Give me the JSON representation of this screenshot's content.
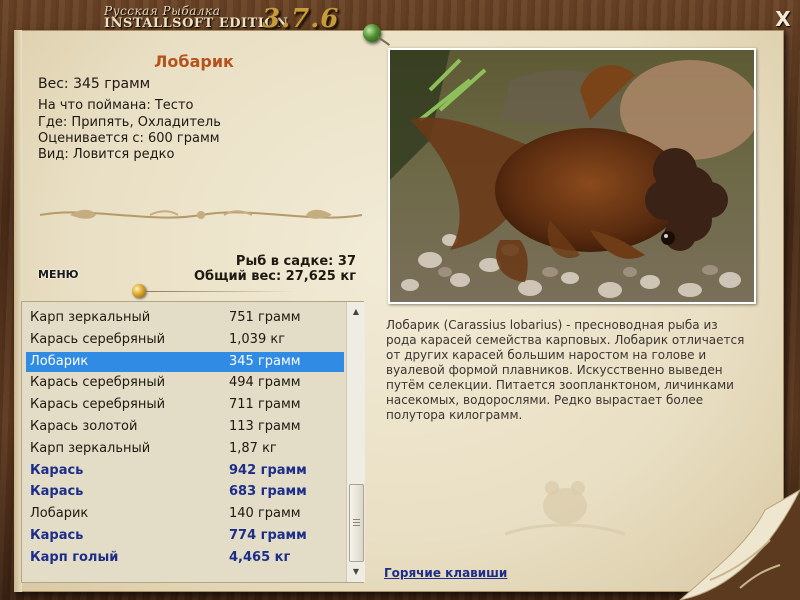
{
  "window": {
    "title_top": "Русская Рыбалка",
    "title_main": "INSTALLSOFT EDITION",
    "version": "3.7.6",
    "close_label": "X"
  },
  "fish": {
    "name": "Лобарик",
    "weight": "Вес: 345 грамм",
    "caught_on": "На что поймана: Тесто",
    "where": "Где: Припять, Охладитель",
    "rated_from": "Оценивается с: 600 грамм",
    "kind": "Вид: Ловится редко",
    "description": "Лобарик (Carassius lobarius) - пресноводная рыба из рода карасей семейства карповых. Лобарик отличается от других карасей большим наростом на голове и вуалевой формой плавников. Искусственно выведен путём селекции. Питается зоопланктоном, личинками насекомых, водорослями. Редко вырастает более полутора килограмм."
  },
  "cage": {
    "count": "Рыб в садке: 37",
    "total_weight": "Общий вес: 27,625 кг"
  },
  "menu_label": "МЕНЮ",
  "hotkeys_label": "Горячие клавиши",
  "catch_list": [
    {
      "name": "Карп зеркальный",
      "weight": "751 грамм",
      "style": "normal"
    },
    {
      "name": "Карась серебряный",
      "weight": "1,039 кг",
      "style": "normal"
    },
    {
      "name": "Лобарик",
      "weight": "345 грамм",
      "style": "selected"
    },
    {
      "name": "Карась серебряный",
      "weight": "494 грамм",
      "style": "normal"
    },
    {
      "name": "Карась серебряный",
      "weight": "711 грамм",
      "style": "normal"
    },
    {
      "name": "Карась золотой",
      "weight": "113 грамм",
      "style": "normal"
    },
    {
      "name": "Карп зеркальный",
      "weight": "1,87 кг",
      "style": "normal"
    },
    {
      "name": "Карась",
      "weight": "942 грамм",
      "style": "bold"
    },
    {
      "name": "Карась",
      "weight": "683 грамм",
      "style": "bold"
    },
    {
      "name": "Лобарик",
      "weight": "140 грамм",
      "style": "normal"
    },
    {
      "name": "Карась",
      "weight": "774 грамм",
      "style": "bold"
    },
    {
      "name": "Карп голый",
      "weight": "4,465 кг",
      "style": "bold"
    }
  ],
  "colors": {
    "fish_name": "#b5531c",
    "bold_row": "#1d2e8a",
    "selected_row": "#2f8be3"
  }
}
